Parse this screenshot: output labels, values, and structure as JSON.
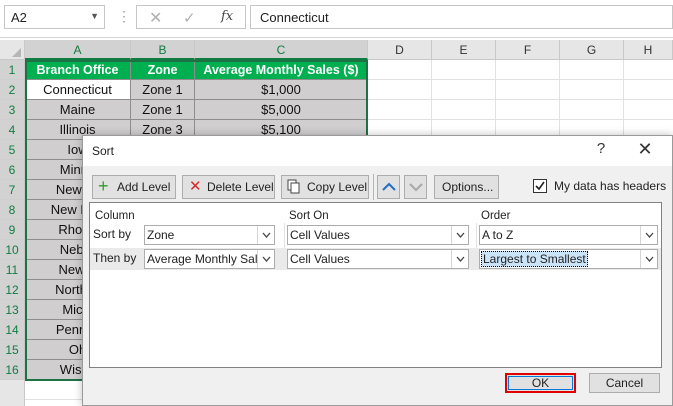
{
  "formula_bar": {
    "name_box": "A2",
    "dots": "⋮",
    "cancel_glyph": "✕",
    "enter_glyph": "✓",
    "fx": "fx",
    "content": "Connecticut"
  },
  "sheet": {
    "columns": [
      "A",
      "B",
      "C",
      "D",
      "E",
      "F",
      "G",
      "H"
    ],
    "rows": [
      "1",
      "2",
      "3",
      "4",
      "5",
      "6",
      "7",
      "8",
      "9",
      "10",
      "11",
      "12",
      "13",
      "14",
      "15",
      "16"
    ],
    "header": [
      "Branch Office",
      "Zone",
      "Average Monthly Sales ($)"
    ],
    "data": [
      [
        "Connecticut",
        "Zone 1",
        "$1,000"
      ],
      [
        "Maine",
        "Zone 1",
        "$5,000"
      ],
      [
        "Illinois",
        "Zone 3",
        "$5,100"
      ],
      [
        "Iow",
        "",
        ""
      ],
      [
        "Minne",
        "",
        ""
      ],
      [
        "New Je",
        "",
        ""
      ],
      [
        "New Han",
        "",
        ""
      ],
      [
        "Rhode",
        "",
        ""
      ],
      [
        "Nebra",
        "",
        ""
      ],
      [
        "New Y",
        "",
        ""
      ],
      [
        "North D",
        "",
        ""
      ],
      [
        "Michi",
        "",
        ""
      ],
      [
        "Pennsy",
        "",
        ""
      ],
      [
        "Oh",
        "",
        ""
      ],
      [
        "Wisco",
        "",
        ""
      ]
    ],
    "colors": {
      "header_fill": "#00b050",
      "data_fill": "#d0cece",
      "selection": "#107c41"
    }
  },
  "dialog": {
    "title": "Sort",
    "help": "?",
    "close": "✕",
    "toolbar": {
      "add_level": "Add Level",
      "delete_level": "Delete Level",
      "copy_level": "Copy Level",
      "options": "Options...",
      "my_data_has_headers": "My data has headers",
      "headers_checked": true
    },
    "grid_headers": {
      "column": "Column",
      "sort_on": "Sort On",
      "order": "Order"
    },
    "levels": [
      {
        "label": "Sort by",
        "column": "Zone",
        "sort_on": "Cell Values",
        "order": "A to Z"
      },
      {
        "label": "Then by",
        "column": "Average Monthly Sal",
        "sort_on": "Cell Values",
        "order": "Largest to Smallest"
      }
    ],
    "ok": "OK",
    "cancel": "Cancel"
  }
}
